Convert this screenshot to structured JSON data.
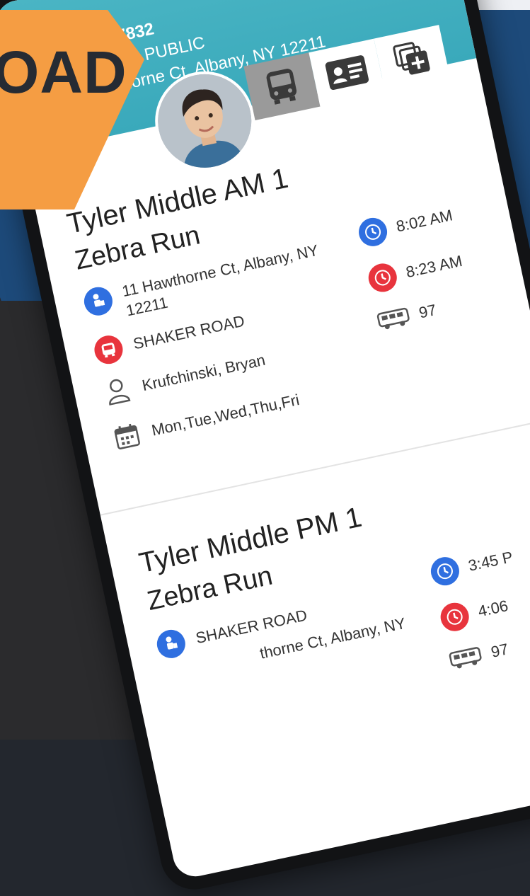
{
  "promo": {
    "text": "OAD",
    "color": "#f59d43"
  },
  "header": {
    "line1": "47832",
    "line2": "06 | PUBLIC",
    "line3": "thorne Ct, Albany, NY 12211",
    "color": "#3aa9bb"
  },
  "tabs": [
    {
      "icon": "bus-icon",
      "selected": true
    },
    {
      "icon": "id-card-icon",
      "selected": false
    },
    {
      "icon": "add-copy-icon",
      "selected": false
    }
  ],
  "routes": [
    {
      "title": "Tyler Middle AM 1",
      "run": "Zebra Run",
      "stop_address": "11 Hawthorne Ct, Albany, NY 12211",
      "school": "SHAKER ROAD",
      "driver": "Krufchinski, Bryan",
      "days": "Mon,Tue,Wed,Thu,Fri",
      "pickup_time": "8:02 AM",
      "dropoff_time": "8:23 AM",
      "bus_number": "97"
    },
    {
      "title": "Tyler Middle PM 1",
      "run": "Zebra Run",
      "school": "SHAKER ROAD",
      "stop_address": "thorne Ct, Albany, NY",
      "pickup_time": "3:45 P",
      "dropoff_time": "4:06",
      "bus_number": "97"
    }
  ],
  "colors": {
    "blue": "#2f6fe0",
    "red": "#e8343d",
    "teal": "#3aa9bb",
    "orange": "#f59d43"
  }
}
